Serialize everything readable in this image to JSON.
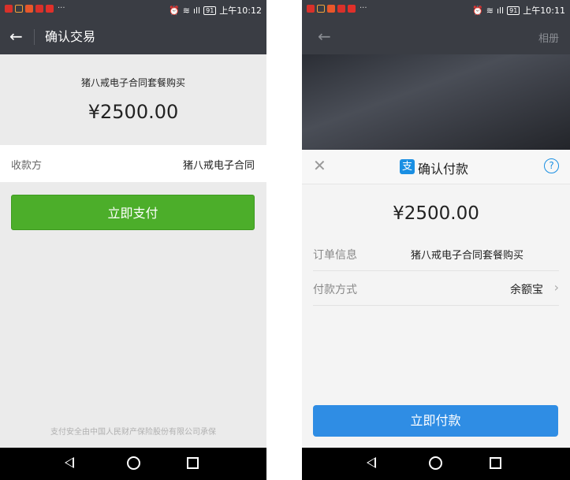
{
  "left": {
    "status": {
      "time": "上午10:12",
      "battery": "91"
    },
    "nav": {
      "title": "确认交易"
    },
    "product": "猪八戒电子合同套餐购买",
    "amount": "¥2500.00",
    "payee": {
      "label": "收款方",
      "value": "猪八戒电子合同"
    },
    "pay_button": "立即支付",
    "footer": "支付安全由中国人民财产保险股份有限公司承保"
  },
  "right": {
    "status": {
      "time": "上午10:11",
      "battery": "91"
    },
    "nav": {
      "album": "相册"
    },
    "sheet": {
      "title": "确认付款",
      "logo": "支",
      "help": "?",
      "amount": "¥2500.00",
      "order": {
        "label": "订单信息",
        "value": "猪八戒电子合同套餐购买"
      },
      "method": {
        "label": "付款方式",
        "value": "余额宝"
      },
      "pay_button": "立即付款"
    }
  },
  "colors": {
    "wechat_green": "#4cae2a",
    "alipay_blue": "#2f8de4",
    "topbar": "#3a3d44"
  },
  "icons": [
    "back-arrow-icon",
    "close-icon",
    "help-icon",
    "chevron-right-icon",
    "alipay-logo-icon",
    "nav-back-icon",
    "nav-home-icon",
    "nav-recent-icon"
  ]
}
